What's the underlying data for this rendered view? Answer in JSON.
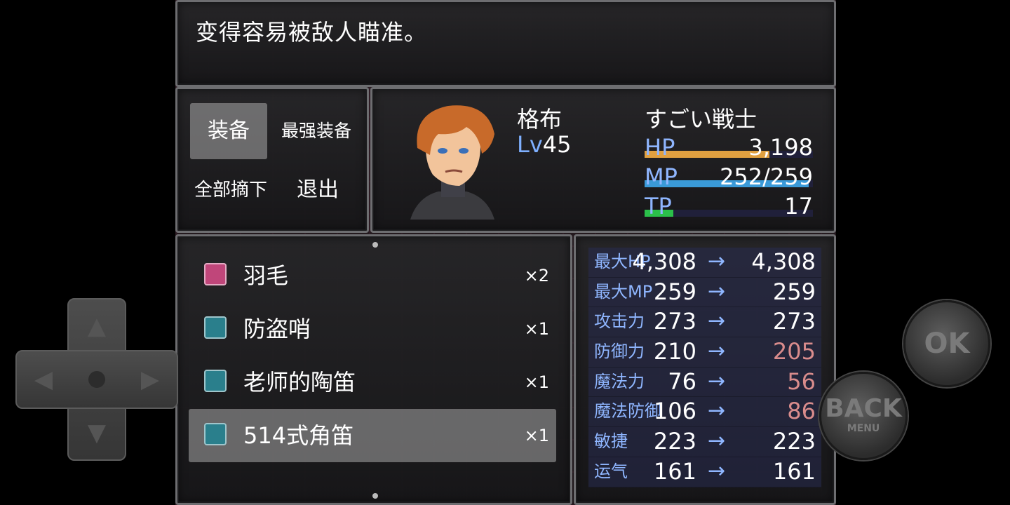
{
  "help": {
    "text": "变得容易被敌人瞄准。"
  },
  "commands": {
    "equip": "装备",
    "optimize": "最强装备",
    "clear": "全部摘下",
    "exit": "退出"
  },
  "actor": {
    "name": "格布",
    "class": "すごい戦士",
    "level_label": "Lv",
    "level": "45",
    "hp_label": "HP",
    "hp": "3,198",
    "hp_ratio": 0.742,
    "mp_label": "MP",
    "mp": "252/259",
    "mp_ratio": 0.973,
    "tp_label": "TP",
    "tp": "17",
    "tp_ratio": 0.17
  },
  "items": [
    {
      "name": "羽毛",
      "qty": "×2",
      "icon": "feather-icon",
      "color": "#c0467a"
    },
    {
      "name": "防盗哨",
      "qty": "×1",
      "icon": "whistle-icon",
      "color": "#2a7f8c"
    },
    {
      "name": "老师的陶笛",
      "qty": "×1",
      "icon": "ocarina-icon",
      "color": "#2a7f8c"
    },
    {
      "name": "514式角笛",
      "qty": "×1",
      "icon": "horn-icon",
      "color": "#2a7f8c"
    }
  ],
  "stats": [
    {
      "label": "最大HP",
      "current": "4,308",
      "new": "4,308",
      "color": "#ffffff"
    },
    {
      "label": "最大MP",
      "current": "259",
      "new": "259",
      "color": "#ffffff"
    },
    {
      "label": "攻击力",
      "current": "273",
      "new": "273",
      "color": "#ffffff"
    },
    {
      "label": "防御力",
      "current": "210",
      "new": "205",
      "color": "#d98c8c"
    },
    {
      "label": "魔法力",
      "current": "76",
      "new": "56",
      "color": "#d98c8c"
    },
    {
      "label": "魔法防御",
      "current": "106",
      "new": "86",
      "color": "#d98c8c"
    },
    {
      "label": "敏捷",
      "current": "223",
      "new": "223",
      "color": "#ffffff"
    },
    {
      "label": "运气",
      "current": "161",
      "new": "161",
      "color": "#ffffff"
    }
  ],
  "arrow": "→",
  "controls": {
    "ok": "OK",
    "back": "BACK",
    "back_sub": "MENU"
  },
  "colors": {
    "hp_gauge": "#e0a040",
    "mp_gauge": "#3a9ad8",
    "tp_gauge": "#2bc04a",
    "status_label": "#8fb6ff",
    "stat_down": "#d98c8c"
  }
}
